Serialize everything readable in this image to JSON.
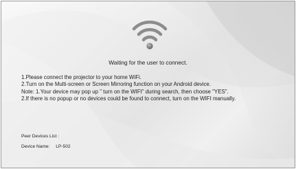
{
  "status_message": "Waiting for the user to connect.",
  "instructions": [
    "1.Please connect the projector to your home WiFi.",
    "2.Turn on the Multi-screen or Screen Mirroring function on your Android device.",
    "Note: 1.Your device may pop up \" turn on the WIFI\" during search, then choose \"YES\".",
    "2.If there is no popup or no devices could be found to connect, turn on the WIFI manually."
  ],
  "peer_devices": {
    "title": "Peer Devices List :",
    "device_label": "Device Name:",
    "device_name": "LP-502"
  },
  "icons": {
    "status_icon": "wifi-icon"
  },
  "colors": {
    "text": "#1e1e1e",
    "icon": "#8c8c8c"
  }
}
